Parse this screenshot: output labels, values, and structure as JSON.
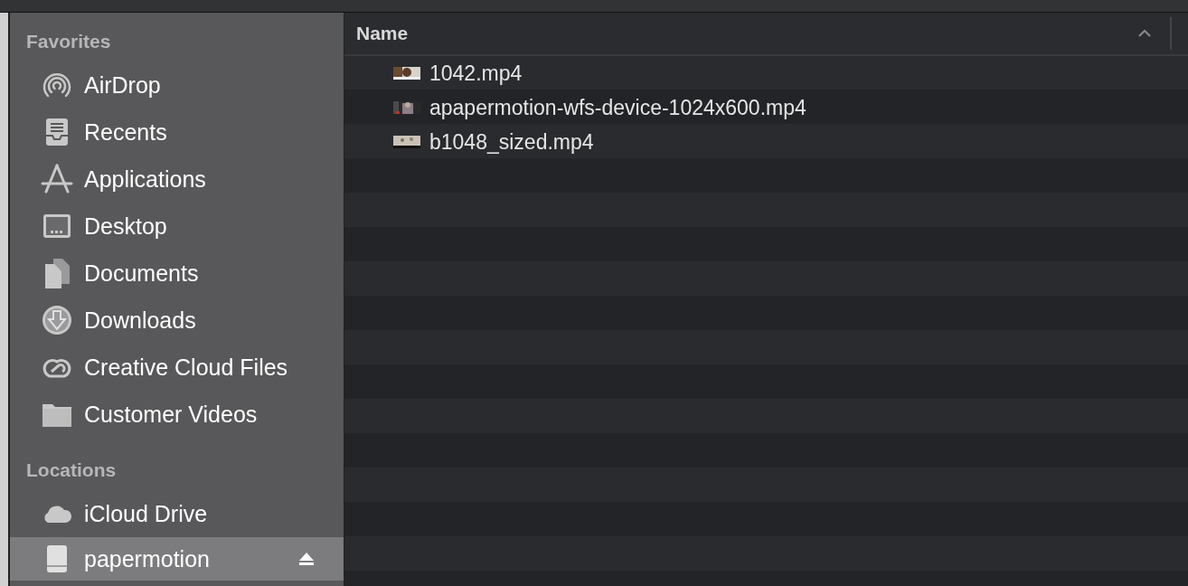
{
  "sidebar": {
    "sections": [
      {
        "title": "Favorites",
        "items": [
          {
            "label": "AirDrop",
            "kind": "airdrop",
            "selected": false
          },
          {
            "label": "Recents",
            "kind": "recents",
            "selected": false
          },
          {
            "label": "Applications",
            "kind": "applications",
            "selected": false
          },
          {
            "label": "Desktop",
            "kind": "desktop",
            "selected": false
          },
          {
            "label": "Documents",
            "kind": "documents",
            "selected": false
          },
          {
            "label": "Downloads",
            "kind": "downloads",
            "selected": false
          },
          {
            "label": "Creative Cloud Files",
            "kind": "creative-cloud",
            "selected": false
          },
          {
            "label": "Customer Videos",
            "kind": "folder",
            "selected": false
          }
        ]
      },
      {
        "title": "Locations",
        "items": [
          {
            "label": "iCloud Drive",
            "kind": "cloud",
            "selected": false
          },
          {
            "label": "papermotion",
            "kind": "drive",
            "selected": true,
            "ejectable": true
          }
        ]
      }
    ]
  },
  "file_list": {
    "columns": [
      {
        "label": "Name",
        "sorted": true
      }
    ],
    "rows": [
      {
        "name": "1042.mp4"
      },
      {
        "name": "apapermotion-wfs-device-1024x600.mp4"
      },
      {
        "name": "b1048_sized.mp4"
      }
    ]
  }
}
